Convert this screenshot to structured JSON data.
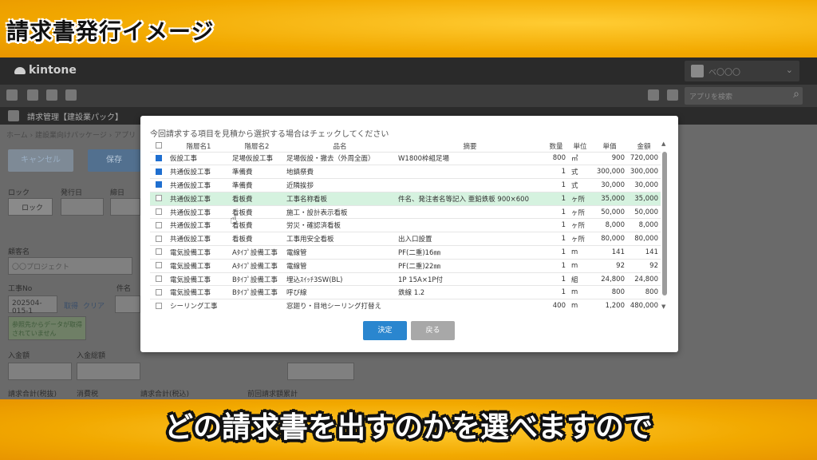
{
  "banner": {
    "title": "請求書発行イメージ",
    "subtitle": "どの請求書を出すのかを選べますので"
  },
  "app": {
    "brand": "kintone",
    "user_name": "ベ〇〇〇",
    "search_placeholder": "アプリを検索",
    "app_name": "請求管理【建設業パック】",
    "breadcrumb": "ホーム › 建設業向けパッケージ › アプリ"
  },
  "form": {
    "cancel_label": "キャンセル",
    "save_label": "保存",
    "lock_label": "ロック",
    "issue_date_label": "発行日",
    "close_date_label": "締日",
    "lock_button": "ロック",
    "customer_label": "顧客名",
    "customer_value": "〇〇プロジェクト",
    "project_no_label": "工事No",
    "project_no_value": "202504-015-1",
    "lookup_get": "取得",
    "lookup_clear": "クリア",
    "item_label": "件名",
    "lookup_note": "参照先からデータが取得されていません",
    "received_label": "入金額",
    "received_total_label": "入金総額",
    "billing_total_label": "請求合計(税抜)",
    "tax_label": "消費税",
    "billing_total_tax_label": "請求合計(税込)",
    "prev_label": "前回請求額累計"
  },
  "dialog": {
    "instruction": "今回請求する項目を見積から選択する場合はチェックしてください",
    "columns": [
      "",
      "階層名1",
      "階層名2",
      "品名",
      "摘要",
      "数量",
      "単位",
      "単価",
      "金額"
    ],
    "rows": [
      {
        "checked": true,
        "highlighted": false,
        "level1": "仮設工事",
        "level2": "足場仮設工事",
        "item": "足場仮設・撤去（外周全面）",
        "note": "W1800枠組足場",
        "qty": "800",
        "unit": "㎡",
        "price": "900",
        "amount": "720,000"
      },
      {
        "checked": true,
        "highlighted": false,
        "level1": "共通仮設工事",
        "level2": "準備費",
        "item": "地鎮祭費",
        "note": "",
        "qty": "1",
        "unit": "式",
        "price": "300,000",
        "amount": "300,000"
      },
      {
        "checked": true,
        "highlighted": false,
        "level1": "共通仮設工事",
        "level2": "準備費",
        "item": "近隣挨拶",
        "note": "",
        "qty": "1",
        "unit": "式",
        "price": "30,000",
        "amount": "30,000"
      },
      {
        "checked": false,
        "highlighted": true,
        "level1": "共通仮設工事",
        "level2": "看板費",
        "item": "工事名称看板",
        "note": "件名、発注者名等記入 亜鉛鉄板 900×600",
        "qty": "1",
        "unit": "ヶ所",
        "price": "35,000",
        "amount": "35,000"
      },
      {
        "checked": false,
        "highlighted": false,
        "level1": "共通仮設工事",
        "level2": "看板費",
        "item": "施工・設計表示看板",
        "note": "",
        "qty": "1",
        "unit": "ヶ所",
        "price": "50,000",
        "amount": "50,000"
      },
      {
        "checked": false,
        "highlighted": false,
        "level1": "共通仮設工事",
        "level2": "看板費",
        "item": "労災・確認済看板",
        "note": "",
        "qty": "1",
        "unit": "ヶ所",
        "price": "8,000",
        "amount": "8,000"
      },
      {
        "checked": false,
        "highlighted": false,
        "level1": "共通仮設工事",
        "level2": "看板費",
        "item": "工事用安全看板",
        "note": "出入口設置",
        "qty": "1",
        "unit": "ヶ所",
        "price": "80,000",
        "amount": "80,000"
      },
      {
        "checked": false,
        "highlighted": false,
        "level1": "電気設備工事",
        "level2": "Aﾀｲﾌﾟ設備工事",
        "item": "電線管",
        "note": "PF(二重)16㎜",
        "qty": "1",
        "unit": "m",
        "price": "141",
        "amount": "141"
      },
      {
        "checked": false,
        "highlighted": false,
        "level1": "電気設備工事",
        "level2": "Aﾀｲﾌﾟ設備工事",
        "item": "電線管",
        "note": "PF(二重)22㎜",
        "qty": "1",
        "unit": "m",
        "price": "92",
        "amount": "92"
      },
      {
        "checked": false,
        "highlighted": false,
        "level1": "電気設備工事",
        "level2": "Bﾀｲﾌﾟ設備工事",
        "item": "埋込ｽｲｯﾁ3SW(BL)",
        "note": "1P 15A×1P付",
        "qty": "1",
        "unit": "組",
        "price": "24,800",
        "amount": "24,800"
      },
      {
        "checked": false,
        "highlighted": false,
        "level1": "電気設備工事",
        "level2": "Bﾀｲﾌﾟ設備工事",
        "item": "呼び線",
        "note": "鉄線 1.2",
        "qty": "1",
        "unit": "m",
        "price": "800",
        "amount": "800"
      },
      {
        "checked": false,
        "highlighted": false,
        "level1": "シーリング工事",
        "level2": "",
        "item": "窓廻り・目地シーリング打替え",
        "note": "",
        "qty": "400",
        "unit": "m",
        "price": "1,200",
        "amount": "480,000"
      }
    ],
    "ok_label": "決定",
    "back_label": "戻る"
  }
}
